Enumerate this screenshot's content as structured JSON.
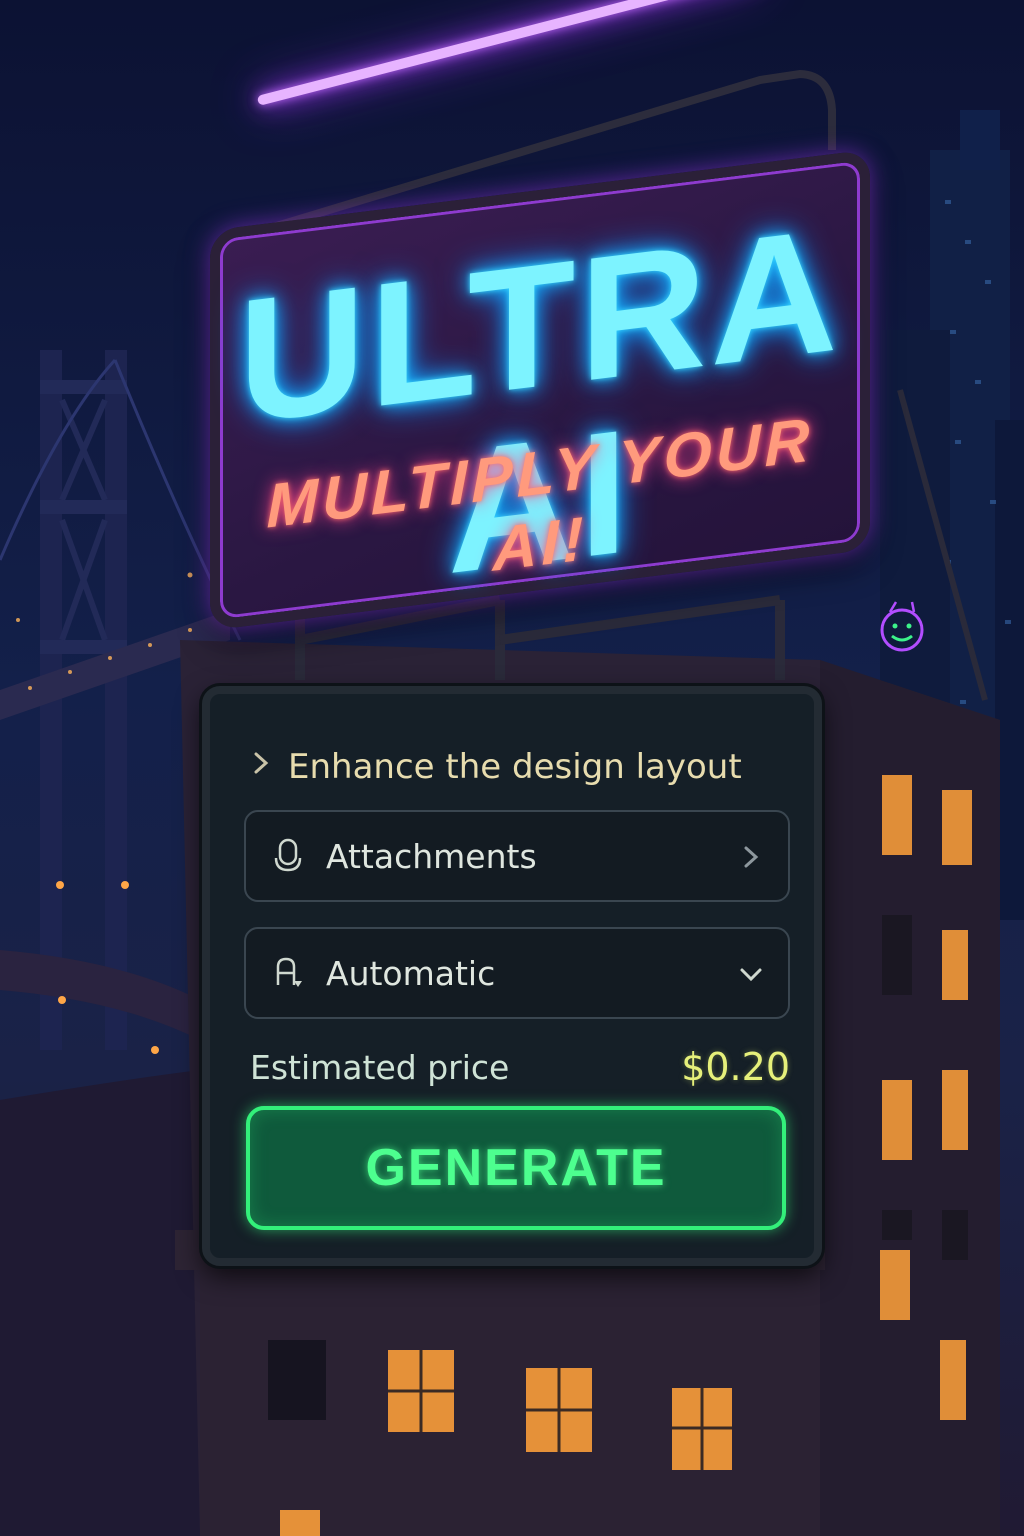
{
  "billboard": {
    "title": "ULTRA AI",
    "tagline": "MULTIPLY YOUR AI!"
  },
  "panel": {
    "prompt": {
      "chevron_icon": "chevron-right-icon",
      "text": "Enhance the design layout"
    },
    "attachments": {
      "icon": "microphone-icon",
      "label": "Attachments",
      "trailing_icon": "chevron-right-icon"
    },
    "model_select": {
      "icon": "font-model-icon",
      "selected": "Automatic",
      "trailing_icon": "chevron-down-icon"
    },
    "price": {
      "label": "Estimated price",
      "value": "$0.20"
    },
    "generate": {
      "label": "GENERATE"
    }
  },
  "colors": {
    "title_neon": "#7df3ff",
    "tagline_neon": "#ff9a7d",
    "purple_neon": "#c46bff",
    "generate_green": "#33f07a",
    "price_yellow": "#e6f07a",
    "prompt_text": "#e7dcae"
  }
}
